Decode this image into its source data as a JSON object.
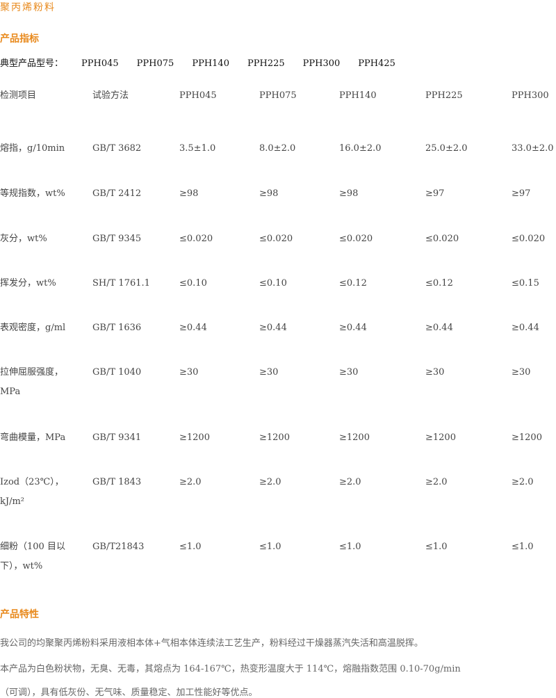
{
  "page_title": "聚丙烯粉料",
  "indicators_heading": "产品指标",
  "typical_models": {
    "label": "典型产品型号：",
    "models": [
      "PPH045",
      "PPH075",
      "PPH140",
      "PPH225",
      "PPH300",
      "PPH425"
    ]
  },
  "spec_table": {
    "headers": [
      "检测项目",
      "试验方法",
      "PPH045",
      "PPH075",
      "PPH140",
      "PPH225",
      "PPH300"
    ],
    "rows": [
      [
        "熔指，g/10min",
        "GB/T 3682",
        "3.5±1.0",
        "8.0±2.0",
        "16.0±2.0",
        "25.0±2.0",
        "33.0±2.0"
      ],
      [
        "等规指数，wt%",
        "GB/T 2412",
        "≥98",
        "≥98",
        "≥98",
        "≥97",
        "≥97"
      ],
      [
        "灰分，wt%",
        "GB/T 9345",
        "≤0.020",
        "≤0.020",
        "≤0.020",
        "≤0.020",
        "≤0.020"
      ],
      [
        "挥发分，wt%",
        "SH/T 1761.1",
        "≤0.10",
        "≤0.10",
        "≤0.12",
        "≤0.12",
        "≤0.15"
      ],
      [
        "表观密度，g/ml",
        "GB/T 1636",
        "≥0.44",
        "≥0.44",
        "≥0.44",
        "≥0.44",
        "≥0.44"
      ],
      [
        "拉伸屈服强度，MPa",
        "GB/T 1040",
        "≥30",
        "≥30",
        "≥30",
        "≥30",
        "≥30"
      ],
      [
        "弯曲模量，MPa",
        "GB/T 9341",
        "≥1200",
        "≥1200",
        "≥1200",
        "≥1200",
        "≥1200"
      ],
      [
        "Izod（23℃），kJ/m²",
        "GB/T 1843",
        "≥2.0",
        "≥2.0",
        "≥2.0",
        "≥2.0",
        "≥2.0"
      ],
      [
        "细粉（100 目以下），wt%",
        "GB/T21843",
        "≤1.0",
        "≤1.0",
        "≤1.0",
        "≤1.0",
        "≤1.0"
      ]
    ]
  },
  "features_heading": "产品特性",
  "paragraphs": [
    "我公司的均聚聚丙烯粉料采用液相本体+气相本体连续法工艺生产，粉料经过干燥器蒸汽失活和高温脱挥。",
    "本产品为白色粉状物，无臭、无毒，其熔点为 164-167℃，热变形温度大于 114℃，熔融指数范围 0.10-70g/min",
    "（可调），具有低灰份、无气味、质量稳定、加工性能好等优点。"
  ]
}
